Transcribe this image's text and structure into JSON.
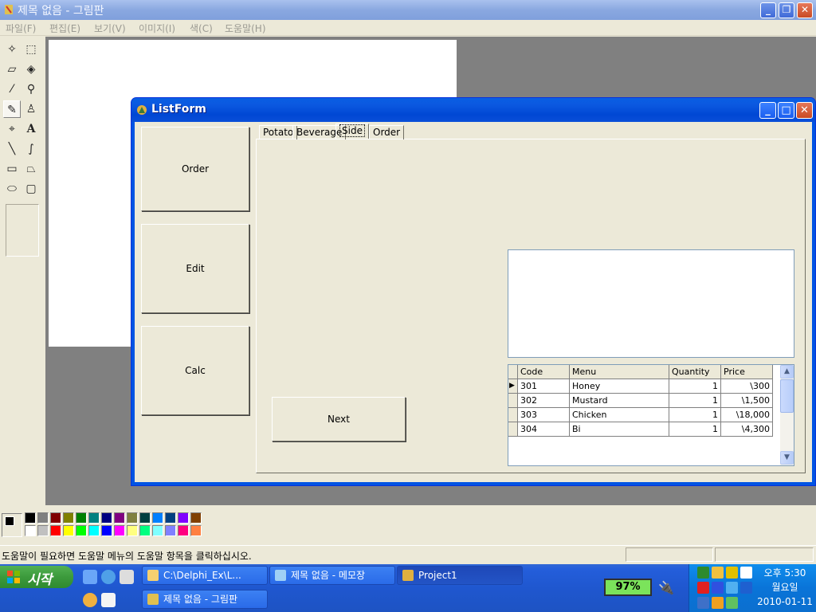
{
  "paint": {
    "title": "제목 없음 - 그림판",
    "menu": [
      "파일(F)",
      "편집(E)",
      "보기(V)",
      "이미지(I)",
      "색(C)",
      "도움말(H)"
    ],
    "tools": [
      {
        "name": "free-form-select-icon",
        "glyph": "⬚"
      },
      {
        "name": "rect-select-icon",
        "glyph": "⬚"
      },
      {
        "name": "eraser-icon",
        "glyph": "▱"
      },
      {
        "name": "fill-icon",
        "glyph": "◈"
      },
      {
        "name": "color-picker-icon",
        "glyph": "⁄"
      },
      {
        "name": "magnifier-icon",
        "glyph": "⚲"
      },
      {
        "name": "pencil-icon",
        "glyph": "✎"
      },
      {
        "name": "brush-icon",
        "glyph": "♙"
      },
      {
        "name": "airbrush-icon",
        "glyph": "⌖"
      },
      {
        "name": "text-icon",
        "glyph": "A"
      },
      {
        "name": "line-icon",
        "glyph": "╲"
      },
      {
        "name": "curve-icon",
        "glyph": "∫"
      },
      {
        "name": "rectangle-icon",
        "glyph": "▭"
      },
      {
        "name": "polygon-icon",
        "glyph": "⏢"
      },
      {
        "name": "ellipse-icon",
        "glyph": "⬭"
      },
      {
        "name": "rounded-rect-icon",
        "glyph": "▢"
      }
    ],
    "palette": [
      "#000000",
      "#808080",
      "#800000",
      "#808000",
      "#008000",
      "#008080",
      "#000080",
      "#800080",
      "#808040",
      "#004040",
      "#0080ff",
      "#004080",
      "#8000ff",
      "#804000",
      "#ffffff",
      "#c0c0c0",
      "#ff0000",
      "#ffff00",
      "#00ff00",
      "#00ffff",
      "#0000ff",
      "#ff00ff",
      "#ffff80",
      "#00ff80",
      "#80ffff",
      "#8080ff",
      "#ff0080",
      "#ff8040"
    ],
    "status_text": "도움말이 필요하면 도움말 메뉴의 도움말 항목을 클릭하십시오."
  },
  "listform": {
    "title": "ListForm",
    "buttons": {
      "order": "Order",
      "edit": "Edit",
      "calc": "Calc",
      "next": "Next"
    },
    "tabs": [
      "Potato",
      "Beverage",
      "Side",
      "Order"
    ],
    "active_tab": "Side",
    "grid": {
      "columns": [
        "Code",
        "Menu",
        "Quantity",
        "Price"
      ],
      "rows": [
        [
          "301",
          "Honey",
          "1",
          "\\300"
        ],
        [
          "302",
          "Mustard",
          "1",
          "\\1,500"
        ],
        [
          "303",
          "Chicken",
          "1",
          "\\18,000"
        ],
        [
          "304",
          "Bi",
          "1",
          "\\4,300"
        ]
      ]
    }
  },
  "taskbar": {
    "start_label": "시작",
    "tasks": [
      "C:\\Delphi_Ex\\L...",
      "제목 없음 - 메모장",
      "Project1",
      "제목 없음 - 그림판"
    ],
    "battery": "97%",
    "clock": {
      "time": "오후 5:30",
      "day": "월요일",
      "date": "2010-01-11"
    }
  }
}
